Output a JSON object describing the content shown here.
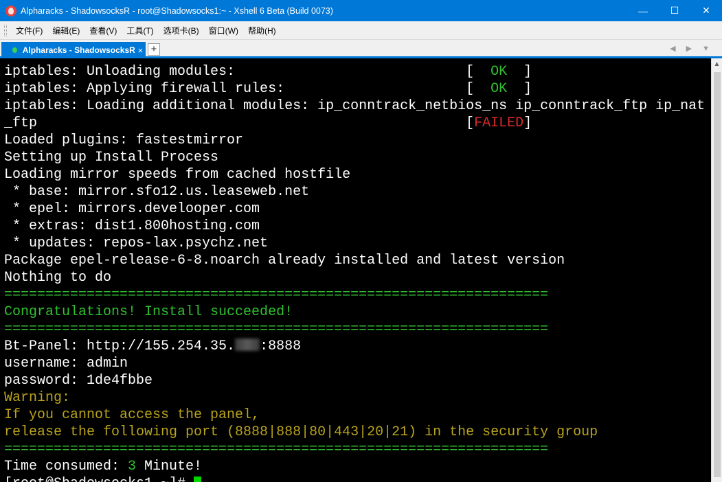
{
  "window": {
    "title": "Alpharacks - ShadowsocksR - root@Shadowsocks1:~ - Xshell 6 Beta (Build 0073)",
    "controls": {
      "minimize": "—",
      "maximize": "☐",
      "close": "✕"
    }
  },
  "menu": {
    "items": [
      "文件(F)",
      "编辑(E)",
      "查看(V)",
      "工具(T)",
      "选项卡(B)",
      "窗口(W)",
      "帮助(H)"
    ]
  },
  "tabs": {
    "active": {
      "label": "Alpharacks - ShadowsocksR",
      "close": "×"
    },
    "add": "+",
    "nav": "◀ ▶ ▼"
  },
  "terminal": {
    "lines": [
      {
        "text": "iptables: Unloading modules:                            ",
        "status_open": "[  ",
        "status": "OK",
        "status_close": "  ]",
        "status_color": "green"
      },
      {
        "text": "iptables: Applying firewall rules:                      ",
        "status_open": "[  ",
        "status": "OK",
        "status_close": "  ]",
        "status_color": "green"
      },
      {
        "text": "iptables: Loading additional modules: ip_conntrack_netbios_ns ip_conntrack_ftp ip_nat"
      },
      {
        "text": "_ftp                                                    ",
        "status_open": "[",
        "status": "FAILED",
        "status_close": "]",
        "status_color": "red"
      },
      {
        "text": "Loaded plugins: fastestmirror"
      },
      {
        "text": "Setting up Install Process"
      },
      {
        "text": "Loading mirror speeds from cached hostfile"
      },
      {
        "text": " * base: mirror.sfo12.us.leaseweb.net"
      },
      {
        "text": " * epel: mirrors.develooper.com"
      },
      {
        "text": " * extras: dist1.800hosting.com"
      },
      {
        "text": " * updates: repos-lax.psychz.net"
      },
      {
        "text": "Package epel-release-6-8.noarch already installed and latest version"
      },
      {
        "text": "Nothing to do"
      },
      {
        "text": "==================================================================",
        "color": "green"
      },
      {
        "text": "Congratulations! Install succeeded!",
        "color": "green"
      },
      {
        "text": "==================================================================",
        "color": "green"
      },
      {
        "text": "Bt-Panel: http://155.254.35.",
        "redacted": true,
        "after": ":8888"
      },
      {
        "text": "username: admin"
      },
      {
        "text": "password: 1de4fbbe"
      },
      {
        "text": "Warning:",
        "color": "yellow"
      },
      {
        "text": "If you cannot access the panel,",
        "color": "yellow"
      },
      {
        "text": "release the following port (8888|888|80|443|20|21) in the security group",
        "color": "yellow"
      },
      {
        "text": "==================================================================",
        "color": "green"
      },
      {
        "text": "Time consumed: ",
        "highlight": "3",
        "after": " Minute!"
      },
      {
        "text": "[root@Shadowsocks1 ~]# ",
        "cursor": true
      }
    ]
  },
  "colors": {
    "titlebar": "#0078d7",
    "terminal_bg": "#000000",
    "ok": "#2fc12f",
    "failed": "#d92b2b",
    "warning": "#b8a31c",
    "cursor": "#00d800"
  }
}
